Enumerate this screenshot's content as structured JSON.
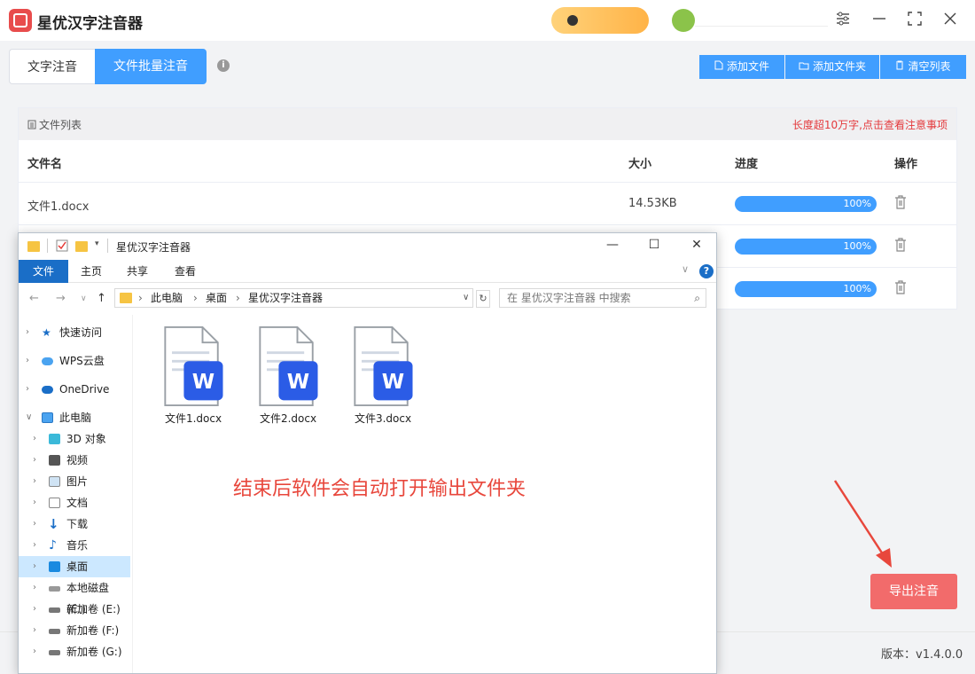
{
  "app": {
    "title": "星优汉字注音器"
  },
  "tabs": [
    {
      "label": "文字注音"
    },
    {
      "label": "文件批量注音"
    }
  ],
  "toolbar": {
    "add_file": "添加文件",
    "add_folder": "添加文件夹",
    "clear_list": "清空列表"
  },
  "file_list": {
    "title": "文件列表",
    "warning": "长度超10万字,点击查看注意事项",
    "columns": {
      "name": "文件名",
      "size": "大小",
      "progress": "进度",
      "action": "操作"
    },
    "rows": [
      {
        "name": "文件1.docx",
        "size": "14.53KB",
        "progress": "100%"
      },
      {
        "name": "",
        "size": "",
        "progress": "100%"
      },
      {
        "name": "",
        "size": "",
        "progress": "100%"
      }
    ]
  },
  "export_button": "导出注音",
  "version": "版本：v1.4.0.0",
  "explorer": {
    "title": "星优汉字注音器",
    "ribbon": [
      "文件",
      "主页",
      "共享",
      "查看"
    ],
    "breadcrumb": [
      "此电脑",
      "桌面",
      "星优汉字注音器"
    ],
    "search_placeholder": "在 星优汉字注音器 中搜索",
    "nav": [
      {
        "label": "快速访问",
        "icon": "star-icon"
      },
      {
        "label": "WPS云盘",
        "icon": "cloud-icon"
      },
      {
        "label": "OneDrive",
        "icon": "onedrive-icon"
      },
      {
        "label": "此电脑",
        "icon": "computer-icon"
      },
      {
        "label": "3D 对象",
        "icon": "cube-icon"
      },
      {
        "label": "视频",
        "icon": "video-icon"
      },
      {
        "label": "图片",
        "icon": "picture-icon"
      },
      {
        "label": "文档",
        "icon": "document-icon"
      },
      {
        "label": "下载",
        "icon": "download-icon"
      },
      {
        "label": "音乐",
        "icon": "music-icon"
      },
      {
        "label": "桌面",
        "icon": "desktop-icon"
      },
      {
        "label": "本地磁盘 (C:)",
        "icon": "disk-icon"
      },
      {
        "label": "新加卷 (E:)",
        "icon": "disk-icon"
      },
      {
        "label": "新加卷 (F:)",
        "icon": "disk-icon"
      },
      {
        "label": "新加卷 (G:)",
        "icon": "disk-icon"
      }
    ],
    "files": [
      {
        "name": "文件1.docx",
        "badge": "W"
      },
      {
        "name": "文件2.docx",
        "badge": "W"
      },
      {
        "name": "文件3.docx",
        "badge": "W"
      }
    ],
    "note": "结束后软件会自动打开输出文件夹"
  },
  "colors": {
    "accent": "#409eff",
    "export": "#f26b6b",
    "warning": "#e4393c",
    "note": "#e8473c",
    "word": "#2b5ce6"
  }
}
